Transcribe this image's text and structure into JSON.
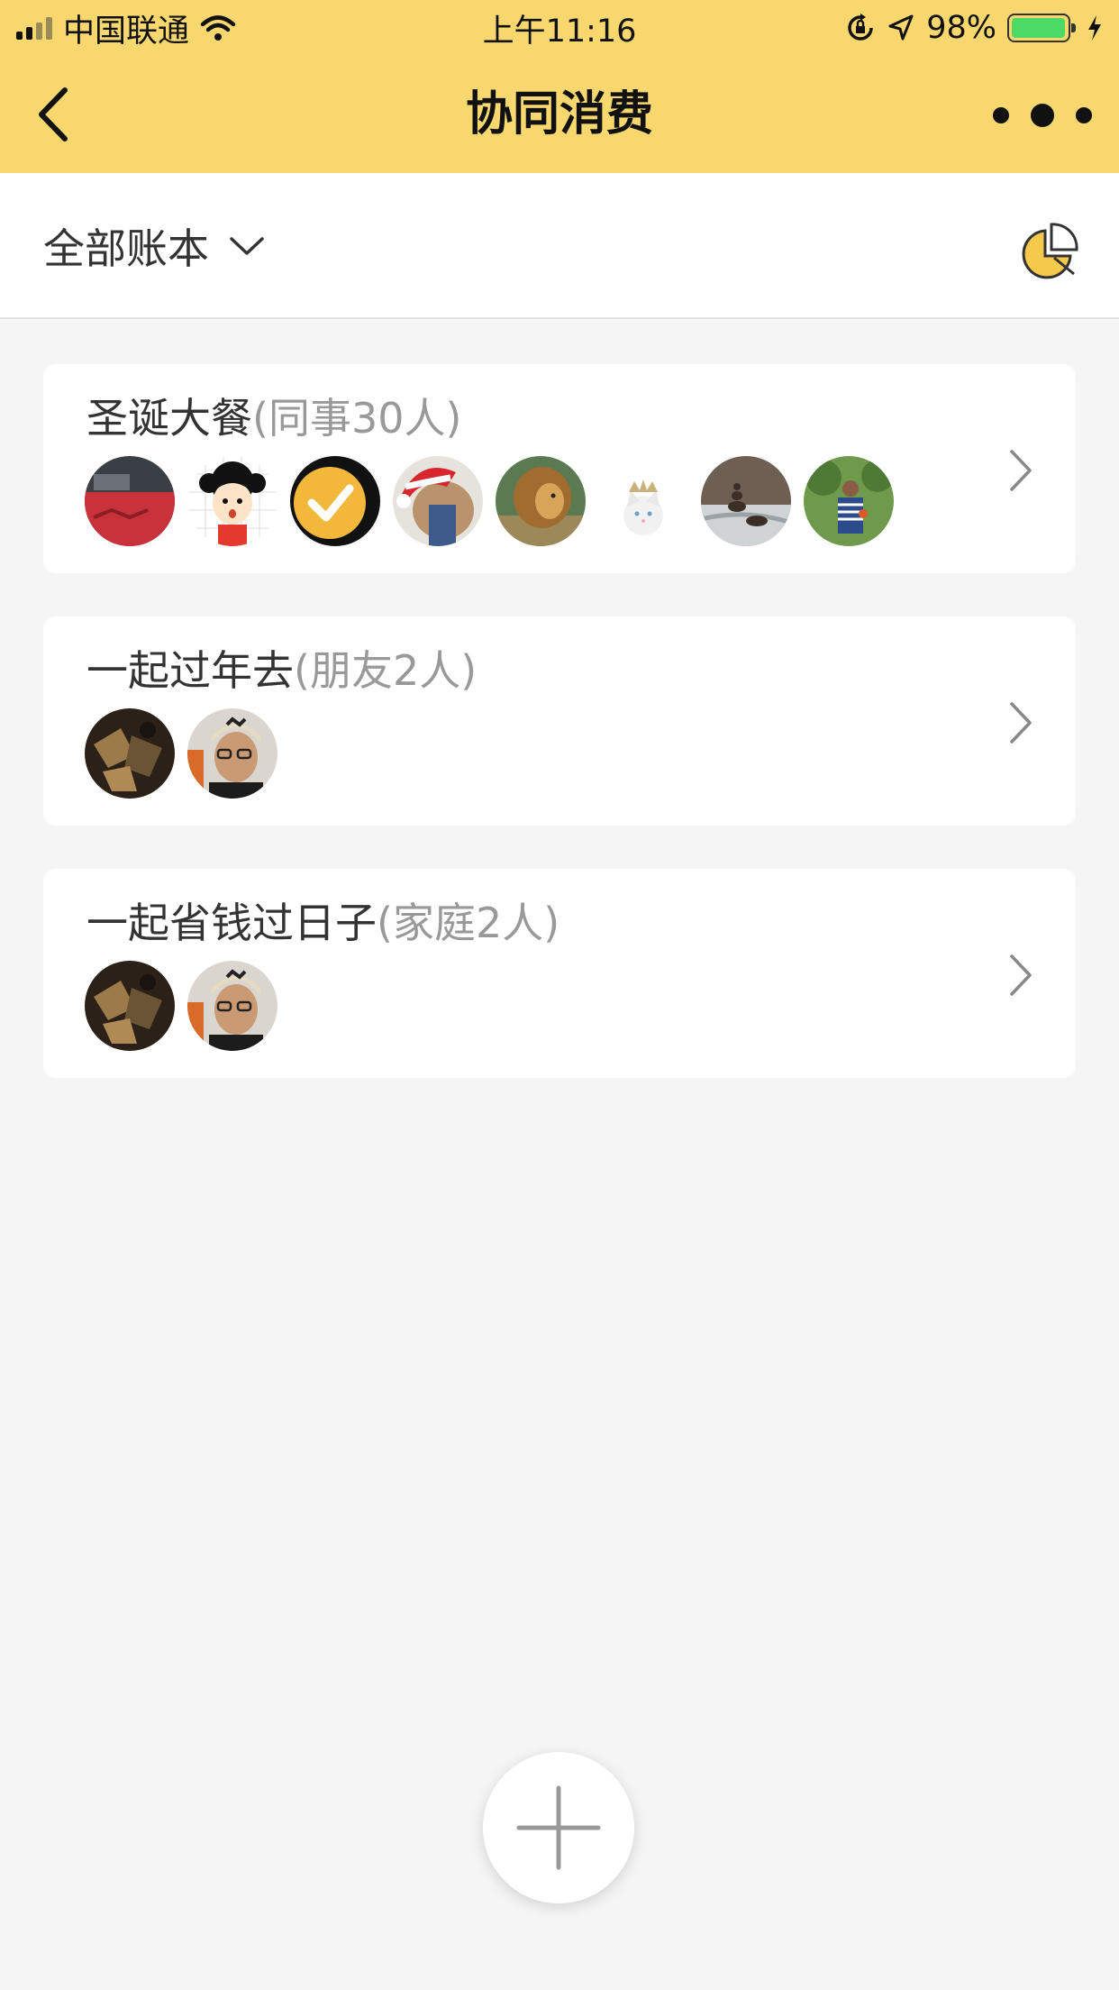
{
  "status_bar": {
    "carrier": "中国联通",
    "time": "上午11:16",
    "battery_percent": "98%",
    "battery_level": 0.98,
    "signal_bars": 4,
    "signal_bars_active": 2
  },
  "nav": {
    "title": "协同消费",
    "back_icon": "chevron-left-icon",
    "more_icon": "more-dots-icon"
  },
  "filter": {
    "label": "全部账本",
    "dropdown_icon": "chevron-down-icon",
    "chart_icon": "pie-chart-icon"
  },
  "ledgers": [
    {
      "name": "圣诞大餐",
      "group": "(同事30人)",
      "avatars": [
        "red-photo-avatar",
        "cartoon-girl-avatar",
        "checkmark-avatar",
        "santa-hat-animal-avatar",
        "lion-avatar",
        "white-cat-avatar",
        "stone-balance-avatar",
        "person-outdoor-avatar"
      ]
    },
    {
      "name": "一起过年去",
      "group": "(朋友2人)",
      "avatars": [
        "food-photo-avatar",
        "man-cap-avatar"
      ]
    },
    {
      "name": "一起省钱过日子",
      "group": "(家庭2人)",
      "avatars": [
        "food-photo-avatar",
        "man-cap-avatar"
      ]
    }
  ],
  "fab": {
    "icon": "plus-icon"
  },
  "colors": {
    "header_bg": "#f8d86e",
    "page_bg": "#f5f5f5",
    "card_bg": "#ffffff",
    "accent": "#f5c94c",
    "muted_text": "#999999"
  }
}
